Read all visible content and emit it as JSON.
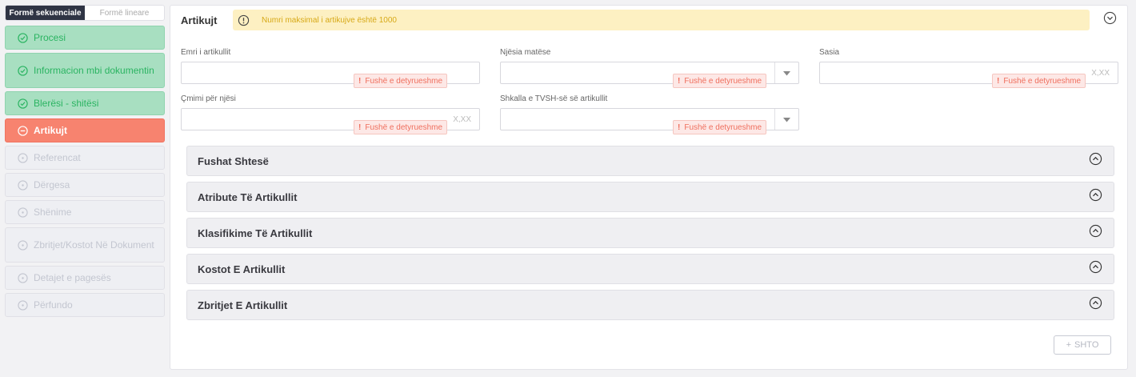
{
  "sidebar": {
    "modes": [
      {
        "label": "Formë sekuenciale",
        "active": true
      },
      {
        "label": "Formë lineare",
        "active": false
      }
    ],
    "steps": [
      {
        "label": "Procesi",
        "state": "done"
      },
      {
        "label": "Informacion mbi dokumentin",
        "state": "done"
      },
      {
        "label": "Blerësi - shitësi",
        "state": "done"
      },
      {
        "label": "Artikujt",
        "state": "active"
      },
      {
        "label": "Referencat",
        "state": "pending"
      },
      {
        "label": "Dërgesa",
        "state": "pending"
      },
      {
        "label": "Shënime",
        "state": "pending"
      },
      {
        "label": "Zbritjet/Kostot Në Dokument",
        "state": "pending"
      },
      {
        "label": "Detajet e pagesës",
        "state": "pending"
      },
      {
        "label": "Përfundo",
        "state": "pending"
      }
    ]
  },
  "section": {
    "title": "Artikujt",
    "warning": "Numri maksimal i artikujve është 1000"
  },
  "fields": {
    "name": {
      "label": "Emri i artikullit",
      "value": "",
      "error": "Fushë e detyrueshme"
    },
    "unit": {
      "label": "Njësia matëse",
      "value": "",
      "error": "Fushë e detyrueshme"
    },
    "quantity": {
      "label": "Sasia",
      "value": "",
      "placeholder": "X,XX",
      "error": "Fushë e detyrueshme"
    },
    "price": {
      "label": "Çmimi për njësi",
      "value": "",
      "placeholder": "X,XX",
      "error": "Fushë e detyrueshme"
    },
    "vat": {
      "label": "Shkalla e TVSH-së së artikullit",
      "value": "",
      "error": "Fushë e detyrueshme"
    }
  },
  "accordions": [
    {
      "title": "Fushat Shtesë"
    },
    {
      "title": "Atribute Të Artikullit"
    },
    {
      "title": "Klasifikime Të Artikullit"
    },
    {
      "title": "Kostot E Artikullit"
    },
    {
      "title": "Zbritjet E Artikullit"
    }
  ],
  "actions": {
    "add_label": "SHTO"
  },
  "colors": {
    "done": "#2bb462",
    "active": "#f7836f",
    "warning": "#d7a917",
    "error": "#ef6f5e"
  }
}
